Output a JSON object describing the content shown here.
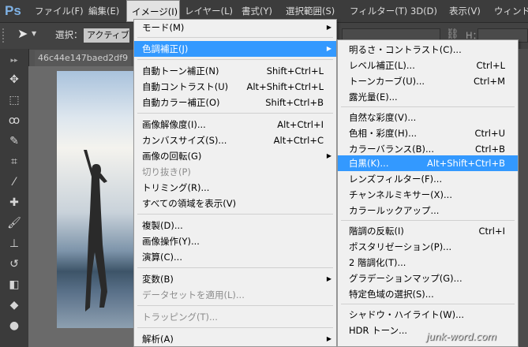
{
  "menubar": {
    "logo": "Ps",
    "items": [
      {
        "label": "ファイル(F)"
      },
      {
        "label": "編集(E)"
      },
      {
        "label": "イメージ(I)"
      },
      {
        "label": "レイヤー(L)"
      },
      {
        "label": "書式(Y)"
      },
      {
        "label": "選択範囲(S)"
      },
      {
        "label": "フィルター(T)"
      },
      {
        "label": "3D(D)"
      },
      {
        "label": "表示(V)"
      },
      {
        "label": "ウィンドウ"
      }
    ]
  },
  "optionsbar": {
    "select_label": "選択：",
    "auto_select_value": "アクティブ",
    "link_icon": "link-icon",
    "h_label": "H："
  },
  "document": {
    "tab_title": "46c44e147baed2df9"
  },
  "image_menu": {
    "items": [
      {
        "label": "モード(M)",
        "shortcut": "",
        "submenu": true
      },
      {
        "label": "色調補正(J)",
        "shortcut": "",
        "submenu": true,
        "highlighted": true
      },
      {
        "label": "自動トーン補正(N)",
        "shortcut": "Shift+Ctrl+L"
      },
      {
        "label": "自動コントラスト(U)",
        "shortcut": "Alt+Shift+Ctrl+L"
      },
      {
        "label": "自動カラー補正(O)",
        "shortcut": "Shift+Ctrl+B"
      },
      {
        "label": "画像解像度(I)...",
        "shortcut": "Alt+Ctrl+I"
      },
      {
        "label": "カンバスサイズ(S)...",
        "shortcut": "Alt+Ctrl+C"
      },
      {
        "label": "画像の回転(G)",
        "shortcut": "",
        "submenu": true
      },
      {
        "label": "切り抜き(P)",
        "shortcut": "",
        "disabled": true
      },
      {
        "label": "トリミング(R)...",
        "shortcut": ""
      },
      {
        "label": "すべての領域を表示(V)",
        "shortcut": ""
      },
      {
        "label": "複製(D)...",
        "shortcut": ""
      },
      {
        "label": "画像操作(Y)...",
        "shortcut": ""
      },
      {
        "label": "演算(C)...",
        "shortcut": ""
      },
      {
        "label": "変数(B)",
        "shortcut": "",
        "submenu": true
      },
      {
        "label": "データセットを適用(L)...",
        "shortcut": "",
        "disabled": true
      },
      {
        "label": "トラッピング(T)...",
        "shortcut": "",
        "disabled": true
      },
      {
        "label": "解析(A)",
        "shortcut": "",
        "submenu": true
      }
    ]
  },
  "adjust_submenu": {
    "items": [
      {
        "label": "明るさ・コントラスト(C)...",
        "shortcut": ""
      },
      {
        "label": "レベル補正(L)...",
        "shortcut": "Ctrl+L"
      },
      {
        "label": "トーンカーブ(U)...",
        "shortcut": "Ctrl+M"
      },
      {
        "label": "露光量(E)...",
        "shortcut": ""
      },
      {
        "label": "自然な彩度(V)...",
        "shortcut": ""
      },
      {
        "label": "色相・彩度(H)...",
        "shortcut": "Ctrl+U"
      },
      {
        "label": "カラーバランス(B)...",
        "shortcut": "Ctrl+B"
      },
      {
        "label": "白黒(K)...",
        "shortcut": "Alt+Shift+Ctrl+B",
        "highlighted": true
      },
      {
        "label": "レンズフィルター(F)...",
        "shortcut": ""
      },
      {
        "label": "チャンネルミキサー(X)...",
        "shortcut": ""
      },
      {
        "label": "カラールックアップ...",
        "shortcut": ""
      },
      {
        "label": "階調の反転(I)",
        "shortcut": "Ctrl+I"
      },
      {
        "label": "ポスタリゼーション(P)...",
        "shortcut": ""
      },
      {
        "label": "2 階調化(T)...",
        "shortcut": ""
      },
      {
        "label": "グラデーションマップ(G)...",
        "shortcut": ""
      },
      {
        "label": "特定色域の選択(S)...",
        "shortcut": ""
      },
      {
        "label": "シャドウ・ハイライト(W)...",
        "shortcut": ""
      },
      {
        "label": "HDR トーン...",
        "shortcut": ""
      }
    ]
  },
  "watermark": "junk-word.com",
  "colors": {
    "highlight": "#3399ff",
    "menubar_bg": "#3c3c3c",
    "menu_bg": "#f0f0f0"
  }
}
